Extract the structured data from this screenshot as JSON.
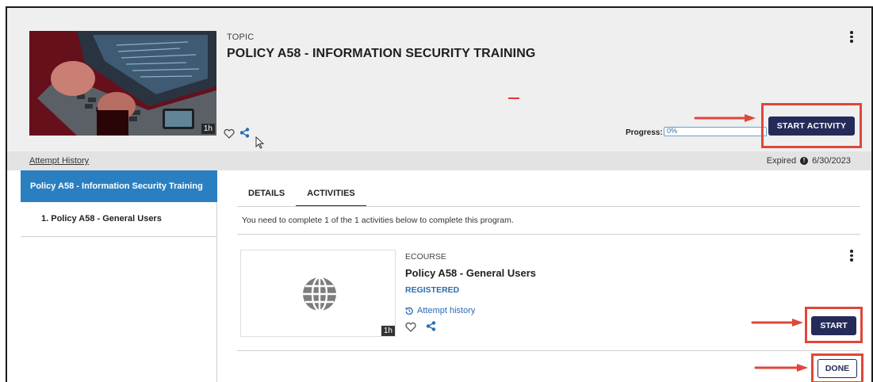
{
  "header": {
    "topic_label": "TOPIC",
    "title": "POLICY A58 - INFORMATION SECURITY TRAINING",
    "thumbnail_duration": "1h",
    "progress_label": "Progress:",
    "progress_value": "0%",
    "progress_fraction": 0,
    "start_activity_label": "START ACTIVITY"
  },
  "strip": {
    "attempt_history_label": "Attempt History",
    "expired_label": "Expired",
    "expired_date": "6/30/2023"
  },
  "sidebar": {
    "items": [
      {
        "label": "Policy A58 - Information Security Training",
        "active": true
      },
      {
        "label": "1. Policy A58 - General Users",
        "active": false
      }
    ]
  },
  "tabs": [
    {
      "label": "DETAILS",
      "active": false
    },
    {
      "label": "ACTIVITIES",
      "active": true
    }
  ],
  "instruction": "You need to complete 1 of the 1 activities below to complete this program.",
  "activity": {
    "type_label": "ECOURSE",
    "title": "Policy A58 - General Users",
    "status": "REGISTERED",
    "attempt_history_label": "Attempt history",
    "duration": "1h",
    "start_label": "START"
  },
  "done_label": "DONE",
  "icons": {
    "like": "heart-icon",
    "share": "share-icon",
    "menu": "kebab-menu-icon",
    "info": "info-icon",
    "history": "history-icon",
    "globe": "globe-icon"
  },
  "colors": {
    "primary_button": "#252b58",
    "sidebar_active": "#2a7fc1",
    "link": "#2a6db1",
    "highlight_box": "#e0463b"
  }
}
